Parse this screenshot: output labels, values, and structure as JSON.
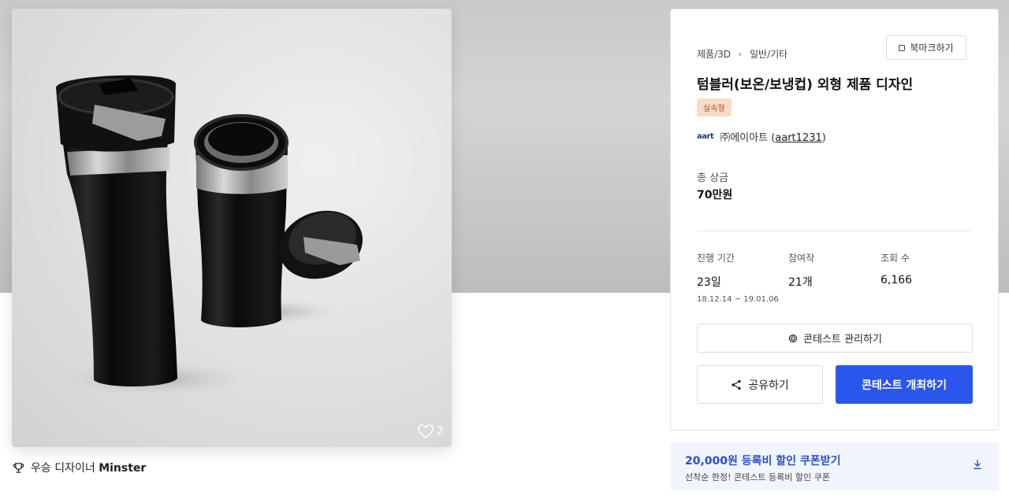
{
  "image": {
    "description_icon": "tumbler-product-render",
    "likes": "2"
  },
  "winner": {
    "prefix": "우승 디자이너",
    "name": "Minster"
  },
  "contest": {
    "category": "제품/3D",
    "subcategory": "일반/기타",
    "bookmark_label": "북마크하기",
    "title": "텀블러(보온/보냉컵) 외형 제품 디자인",
    "badge": "실속형",
    "company_logo": "aart",
    "company_name": "㈜에이아트",
    "company_id": "aart1231",
    "prize_label": "총 상금",
    "prize_value": "70만원",
    "stats": [
      {
        "label": "진행 기간",
        "value": "23일",
        "sub": "18.12.14 ~ 19.01.06"
      },
      {
        "label": "참여작",
        "value": "21개",
        "sub": ""
      },
      {
        "label": "조회 수",
        "value": "6,166",
        "sub": ""
      }
    ],
    "manage_label": "콘테스트 관리하기",
    "share_label": "공유하기",
    "host_label": "콘테스트 개최하기"
  },
  "coupon": {
    "title": "20,000원 등록비 할인 쿠폰받기",
    "subtitle": "선착순 한정! 콘테스트 등록비 할인 쿠폰"
  },
  "colors": {
    "primary": "#2b56ee",
    "coupon_bg": "#f1f5fd",
    "coupon_text": "#2a50c9",
    "badge_bg": "#f6dcc7",
    "badge_text": "#b4522a"
  }
}
